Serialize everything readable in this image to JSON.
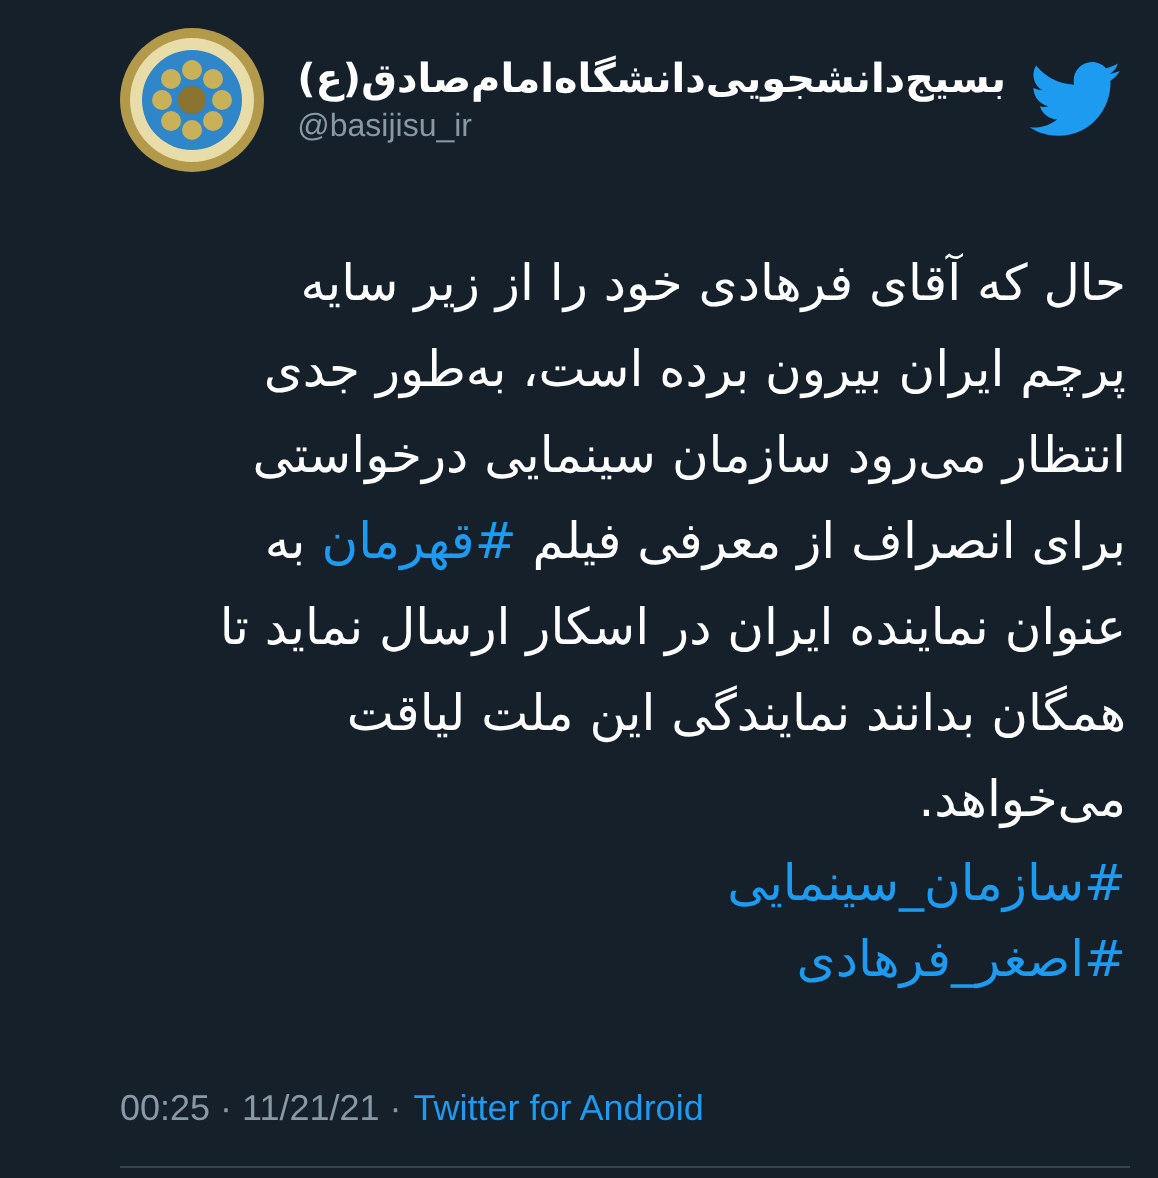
{
  "author": {
    "name": "بسیج‌دانشجویی‌دانشگاه‌امام‌صادق(ع)",
    "handle": "@basijisu_ir"
  },
  "body": [
    [
      {
        "kind": "text",
        "text": "حال که آقای فرهادی خود را از زیر سایه"
      }
    ],
    [
      {
        "kind": "text",
        "text": "پرچم ایران بیرون برده است، به‌طور جدی"
      }
    ],
    [
      {
        "kind": "text",
        "text": "انتظار می‌رود سازمان سینمایی درخواستی"
      }
    ],
    [
      {
        "kind": "text",
        "text": "برای انصراف از معرفی فیلم "
      },
      {
        "kind": "hashtag",
        "text": "#قهرمان"
      },
      {
        "kind": "text",
        "text": " به"
      }
    ],
    [
      {
        "kind": "text",
        "text": "عنوان نماینده ایران در اسکار ارسال نماید تا"
      }
    ],
    [
      {
        "kind": "text",
        "text": "همگان بدانند نمایندگی این ملت لیاقت"
      }
    ],
    [
      {
        "kind": "text",
        "text": "می‌خواهد."
      }
    ]
  ],
  "hashtags": [
    "#سازمان_سینمایی",
    "#اصغر_فرهادی"
  ],
  "meta": {
    "timestamp": "00:25 · 11/21/21 ·",
    "source": "Twitter for Android"
  }
}
